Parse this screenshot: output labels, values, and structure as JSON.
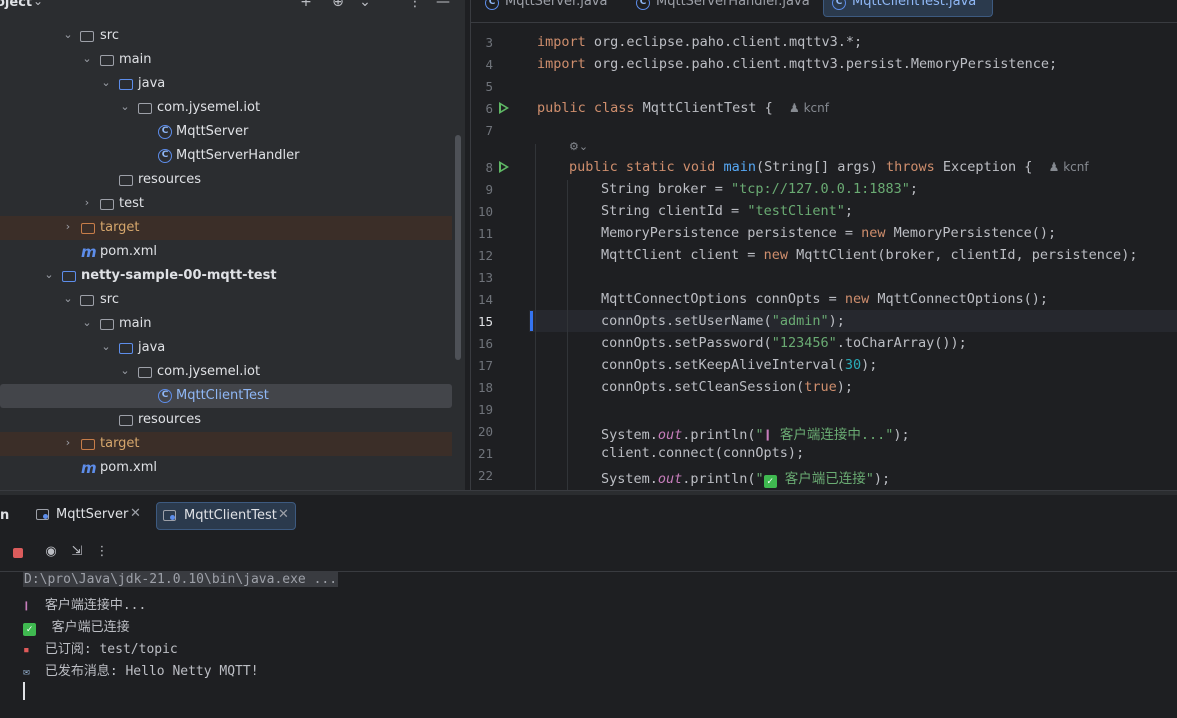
{
  "project": {
    "title": "oject",
    "header_icons": [
      "plus-icon",
      "target-icon",
      "expand-icon",
      "collapse-icon",
      "minimize-icon"
    ],
    "tree": [
      {
        "label": "src",
        "icon": "folder",
        "expanded": true
      },
      {
        "label": "main",
        "icon": "folder",
        "expanded": true
      },
      {
        "label": "java",
        "icon": "folder-blue",
        "expanded": true
      },
      {
        "label": "com.jysemel.iot",
        "icon": "package",
        "expanded": true
      },
      {
        "label": "MqttServer",
        "icon": "class"
      },
      {
        "label": "MqttServerHandler",
        "icon": "class"
      },
      {
        "label": "resources",
        "icon": "resources-folder"
      },
      {
        "label": "test",
        "icon": "folder",
        "expanded": false
      },
      {
        "label": "target",
        "icon": "folder-orange",
        "expanded": false
      },
      {
        "label": "pom.xml",
        "icon": "maven"
      },
      {
        "label": "netty-sample-00-mqtt-test",
        "icon": "module",
        "expanded": true
      },
      {
        "label": "src",
        "icon": "folder",
        "expanded": true
      },
      {
        "label": "main",
        "icon": "folder",
        "expanded": true
      },
      {
        "label": "java",
        "icon": "folder-blue",
        "expanded": true
      },
      {
        "label": "com.jysemel.iot",
        "icon": "package",
        "expanded": true
      },
      {
        "label": "MqttClientTest",
        "icon": "class",
        "selected": true
      },
      {
        "label": "resources",
        "icon": "resources-folder"
      },
      {
        "label": "target",
        "icon": "folder-orange",
        "expanded": false
      },
      {
        "label": "pom.xml",
        "icon": "maven"
      }
    ]
  },
  "editor": {
    "tabs": [
      {
        "label": "MqttServer.java"
      },
      {
        "label": "MqttServerHandler.java"
      },
      {
        "label": "MqttClientTest.java",
        "active": true
      }
    ],
    "line_numbers": [
      "3",
      "4",
      "5",
      "6",
      "7",
      "",
      "8",
      "9",
      "10",
      "11",
      "12",
      "13",
      "14",
      "15",
      "16",
      "17",
      "18",
      "19",
      "20",
      "21",
      "22"
    ],
    "current_line": "15",
    "author_hint": "kcnf",
    "code": {
      "l3_kw": "import",
      "l3_rest": " org.eclipse.paho.client.mqttv3.*;",
      "l4_kw": "import",
      "l4_rest": " org.eclipse.paho.client.mqttv3.persist.MemoryPersistence;",
      "l6_kw": "public class",
      "l6_rest": " MqttClientTest {",
      "l8_kw": "public static void",
      "l8_fn": "main",
      "l8_mid": "(String[] args) ",
      "l8_kw2": "throws",
      "l8_rest": " Exception {",
      "l9_a": "String broker = ",
      "l9_s": "\"tcp://127.0.0.1:1883\"",
      "l9_b": ";",
      "l10_a": "String clientId = ",
      "l10_s": "\"testClient\"",
      "l10_b": ";",
      "l11_a": "MemoryPersistence persistence = ",
      "l11_kw": "new",
      "l11_b": " MemoryPersistence();",
      "l12_a": "MqttClient client = ",
      "l12_kw": "new",
      "l12_b": " MqttClient(broker, clientId, persistence);",
      "l14_a": "MqttConnectOptions connOpts = ",
      "l14_kw": "new",
      "l14_b": " MqttConnectOptions();",
      "l15_a": "connOpts.setUserName(",
      "l15_s": "\"admin\"",
      "l15_b": ");",
      "l16_a": "connOpts.setPassword(",
      "l16_s": "\"123456\"",
      "l16_b": ".toCharArray());",
      "l17_a": "connOpts.setKeepAliveInterval(",
      "l17_n": "30",
      "l17_b": ");",
      "l18_a": "connOpts.setCleanSession(",
      "l18_kw": "true",
      "l18_b": ");",
      "l20_a": "System.",
      "l20_it": "out",
      "l20_b": ".println(",
      "l20_s1": "\"",
      "l20_s2": " 客户端连接中...\"",
      "l20_c": ");",
      "l21": "client.connect(connOpts);",
      "l22_a": "System.",
      "l22_it": "out",
      "l22_b": ".println(",
      "l22_s1": "\"",
      "l22_s2": " 客户端已连接\"",
      "l22_c": ");"
    }
  },
  "run": {
    "panel_label": "n",
    "tabs": [
      {
        "label": "MqttServer"
      },
      {
        "label": "MqttClientTest",
        "active": true
      }
    ],
    "console": {
      "command": "D:\\pro\\Java\\jdk-21.0.10\\bin\\java.exe ...",
      "lines": [
        "客户端连接中...",
        "客户端已连接",
        "已订阅: test/topic",
        "已发布消息: Hello Netty MQTT!"
      ]
    }
  }
}
